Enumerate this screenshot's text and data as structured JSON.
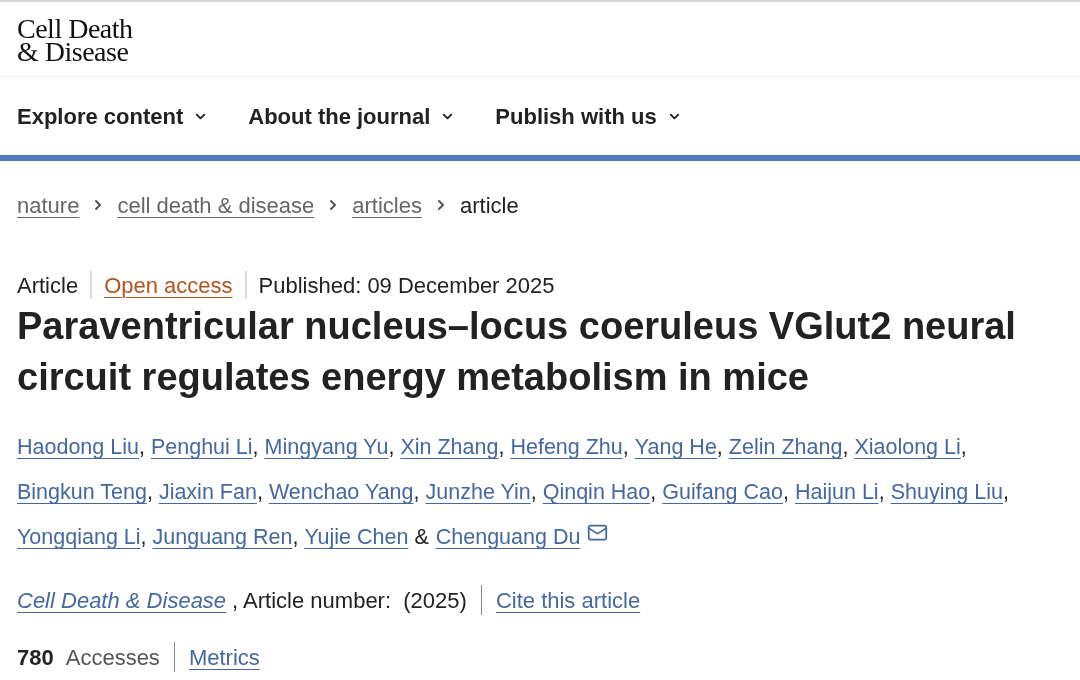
{
  "header": {
    "logo_lines": [
      "Cell Death",
      "& Disease"
    ]
  },
  "nav": [
    {
      "label": "Explore content",
      "expanded": false
    },
    {
      "label": "About the journal",
      "expanded": false
    },
    {
      "label": "Publish with us",
      "expanded": false
    }
  ],
  "breadcrumb": [
    {
      "label": "nature",
      "current": false
    },
    {
      "label": "cell death & disease",
      "current": false
    },
    {
      "label": "articles",
      "current": false
    },
    {
      "label": "article",
      "current": true
    }
  ],
  "article": {
    "type": "Article",
    "access": "Open access",
    "published": "Published: 09 December 2025",
    "title": "Paraventricular nucleus–locus coeruleus VGlut2 neural circuit regulates energy metabolism in mice",
    "authors": [
      {
        "name": "Haodong Liu",
        "punctuation": ",",
        "corresponding": false
      },
      {
        "name": "Penghui Li",
        "punctuation": ",",
        "corresponding": false
      },
      {
        "name": "Mingyang Yu",
        "punctuation": ",",
        "corresponding": false
      },
      {
        "name": "Xin Zhang",
        "punctuation": ",",
        "corresponding": false
      },
      {
        "name": "Hefeng Zhu",
        "punctuation": ",",
        "corresponding": false
      },
      {
        "name": "Yang He",
        "punctuation": ",",
        "corresponding": false
      },
      {
        "name": "Zelin Zhang",
        "punctuation": ",",
        "corresponding": false
      },
      {
        "name": "Xiaolong Li",
        "punctuation": ",",
        "corresponding": false
      },
      {
        "name": "Bingkun Teng",
        "punctuation": ",",
        "corresponding": false
      },
      {
        "name": "Jiaxin Fan",
        "punctuation": ",",
        "corresponding": false
      },
      {
        "name": "Wenchao Yang",
        "punctuation": ",",
        "corresponding": false
      },
      {
        "name": "Junzhe Yin",
        "punctuation": ",",
        "corresponding": false
      },
      {
        "name": "Qinqin Hao",
        "punctuation": ",",
        "corresponding": false
      },
      {
        "name": "Guifang Cao",
        "punctuation": ",",
        "corresponding": false
      },
      {
        "name": "Haijun Li",
        "punctuation": ",",
        "corresponding": false
      },
      {
        "name": "Shuying Liu",
        "punctuation": ",",
        "corresponding": false
      },
      {
        "name": "Yongqiang Li",
        "punctuation": ",",
        "corresponding": false
      },
      {
        "name": "Junguang Ren",
        "punctuation": ",",
        "corresponding": false
      },
      {
        "name": "Yujie Chen",
        "corresponding": false
      },
      {
        "conjunction": "&",
        "name": "Chenguang Du",
        "corresponding": true
      }
    ],
    "citation": {
      "journal": "Cell Death & Disease",
      "details": ", Article number:  (2025)",
      "cite_link": "Cite this article"
    },
    "metrics": {
      "accesses_count": "780",
      "accesses_label": "Accesses",
      "metrics_link": "Metrics"
    }
  }
}
